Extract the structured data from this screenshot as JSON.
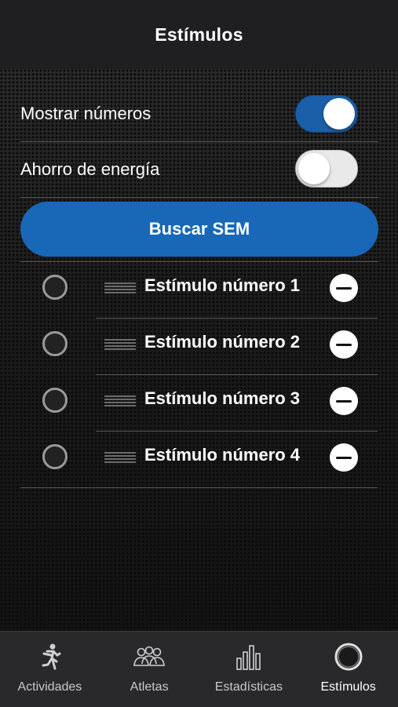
{
  "header": {
    "title": "Estímulos"
  },
  "settings": {
    "show_numbers": {
      "label": "Mostrar números",
      "enabled": true
    },
    "power_saving": {
      "label": "Ahorro de energía",
      "enabled": false
    }
  },
  "scan_button": {
    "label": "Buscar SEM"
  },
  "stimuli": [
    {
      "label": "Estímulo número 1"
    },
    {
      "label": "Estímulo número 2"
    },
    {
      "label": "Estímulo número 3"
    },
    {
      "label": "Estímulo número 4"
    }
  ],
  "tabbar": {
    "items": [
      {
        "label": "Actividades",
        "icon": "runner-icon"
      },
      {
        "label": "Atletas",
        "icon": "athletes-icon"
      },
      {
        "label": "Estadísticas",
        "icon": "bar-chart-icon"
      },
      {
        "label": "Estímulos",
        "icon": "ring-icon",
        "active": true
      }
    ]
  },
  "colors": {
    "accent": "#1868b7",
    "background": "#1c1c1c",
    "tabbar": "#29292b"
  }
}
